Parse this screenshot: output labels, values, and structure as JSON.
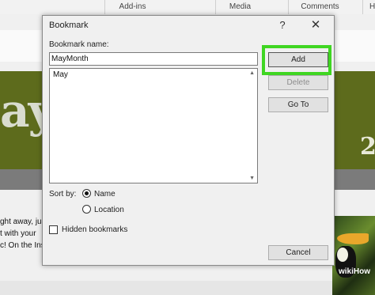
{
  "ribbon": {
    "tabs": [
      "Add-ins",
      "Media",
      "Comments",
      "H"
    ]
  },
  "document": {
    "big_text": "ay",
    "big_number": "2",
    "lines": [
      "ght away, just",
      "t with your",
      "c! On the Ins"
    ],
    "watermark": "wikiHow"
  },
  "dialog": {
    "title": "Bookmark",
    "help_glyph": "?",
    "close_glyph": "✕",
    "name_label": "Bookmark name:",
    "name_value": "MayMonth",
    "list_items": [
      "May"
    ],
    "buttons": {
      "add": "Add",
      "delete": "Delete",
      "goto": "Go To",
      "cancel": "Cancel"
    },
    "sort_by_label": "Sort by:",
    "sort_options": {
      "name": "Name",
      "location": "Location"
    },
    "sort_selected": "Name",
    "hidden_label": "Hidden bookmarks",
    "hidden_checked": false
  },
  "colors": {
    "highlight": "#3fd622",
    "banner": "#5d6b1c"
  }
}
